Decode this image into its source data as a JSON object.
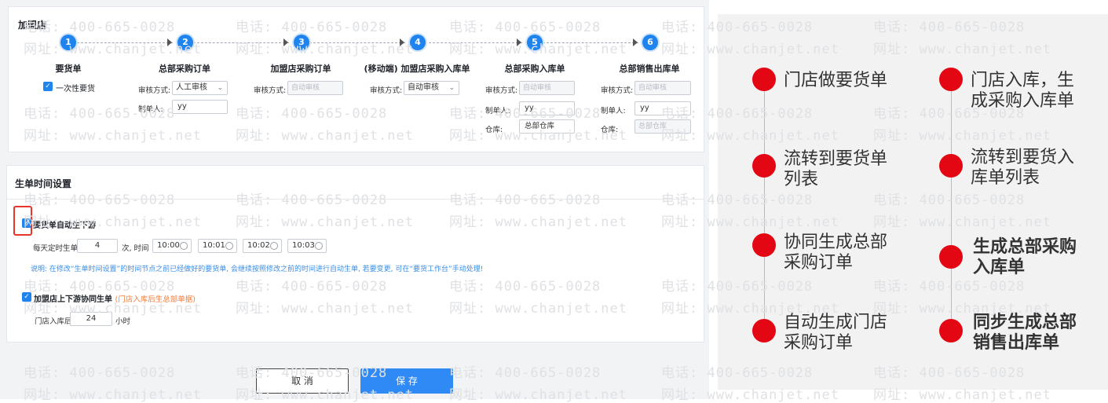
{
  "franchise": {
    "title": "加盟店",
    "steps": [
      {
        "num": "1",
        "label": "要货单"
      },
      {
        "num": "2",
        "label": "总部采购订单"
      },
      {
        "num": "3",
        "label": "加盟店采购订单"
      },
      {
        "num": "4",
        "label": "(移动端) 加盟店采购入库单"
      },
      {
        "num": "5",
        "label": "总部采购入库单"
      },
      {
        "num": "6",
        "label": "总部销售出库单"
      }
    ],
    "one_time_label": "一次性要货",
    "review_label": "审核方式:",
    "maker_label": "制单人:",
    "warehouse_label": "仓库:",
    "step2_review": "人工审核",
    "step2_maker": "yy",
    "step3_review": "自动审核",
    "step4_review": "自动审核",
    "step5_review": "自动审核",
    "step5_maker": "yy",
    "step5_warehouse": "总部仓库",
    "step6_review": "自动审核",
    "step6_maker": "yy",
    "step6_warehouse": "总部仓库"
  },
  "schedule": {
    "title": "生单时间设置",
    "auto_label": "要货单自动生下游",
    "daily_label": "每天定时生单",
    "count": "4",
    "times_label": "次, 时间",
    "times": [
      "10:00",
      "10:01",
      "10:02",
      "10:03"
    ],
    "note": "说明: 在修改“生单时间设置”的时间节点之前已经做好的要货单, 会继续按照修改之前的时间进行自动生单, 若要变更, 可在“要货工作台”手动处理!",
    "sync_label": "加盟店上下游协同生单",
    "sync_hint": "(门店入库后生总部单据)",
    "store_label": "门店入库后",
    "hours": "24",
    "hours_unit": "小时"
  },
  "buttons": {
    "cancel": "取 消",
    "save": "保 存"
  },
  "flow": {
    "left": [
      {
        "text": "门店做要货单",
        "bold": false
      },
      {
        "text": "流转到要货单列表",
        "bold": false
      },
      {
        "text": "协同生成总部采购订单",
        "bold": false
      },
      {
        "text": "自动生成门店采购订单",
        "bold": false
      }
    ],
    "right": [
      {
        "text": "门店入库，生成采购入库单",
        "bold": false
      },
      {
        "text": "流转到要货入库单列表",
        "bold": false
      },
      {
        "text": "生成总部采购入库单",
        "bold": true
      },
      {
        "text": "同步生成总部销售出库单",
        "bold": true
      }
    ],
    "dot_color": "#e30613"
  },
  "watermark": {
    "phone": "电话: 400-665-0028",
    "site": "网址: www.chanjet.net"
  },
  "colors": {
    "accent": "#1f84ee",
    "save": "#2f8af5",
    "highlight": "#e8342a",
    "hint": "#f07c3a"
  }
}
